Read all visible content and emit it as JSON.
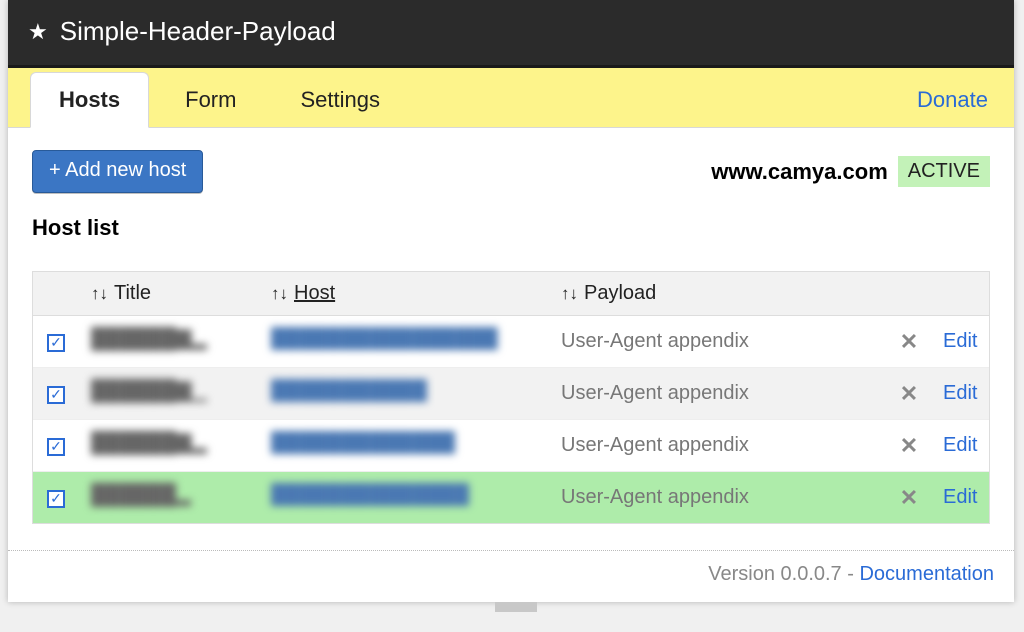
{
  "title": "Simple-Header-Payload",
  "tabs": {
    "hosts": "Hosts",
    "form": "Form",
    "settings": "Settings"
  },
  "donate": "Donate",
  "add_button": "+ Add new host",
  "current_host": "www.camya.com",
  "active_badge": "ACTIVE",
  "section_title": "Host list",
  "columns": {
    "title": "Title",
    "host": "Host",
    "payload": "Payload"
  },
  "rows": [
    {
      "checked": true,
      "title_blur": "██████▇▂",
      "host_blur": "████████████████",
      "payload": "User-Agent appendix",
      "edit": "Edit",
      "highlight": false
    },
    {
      "checked": true,
      "title_blur": "██████▇▁",
      "host_blur": "███████████",
      "payload": "User-Agent appendix",
      "edit": "Edit",
      "highlight": false
    },
    {
      "checked": true,
      "title_blur": "██████▇▂",
      "host_blur": "█████████████",
      "payload": "User-Agent appendix",
      "edit": "Edit",
      "highlight": false
    },
    {
      "checked": true,
      "title_blur": "██████▂",
      "host_blur": "██████████████",
      "payload": "User-Agent appendix",
      "edit": "Edit",
      "highlight": true
    }
  ],
  "footer": {
    "version_label": "Version",
    "version": "0.0.0.7",
    "sep": " - ",
    "doc": "Documentation"
  }
}
